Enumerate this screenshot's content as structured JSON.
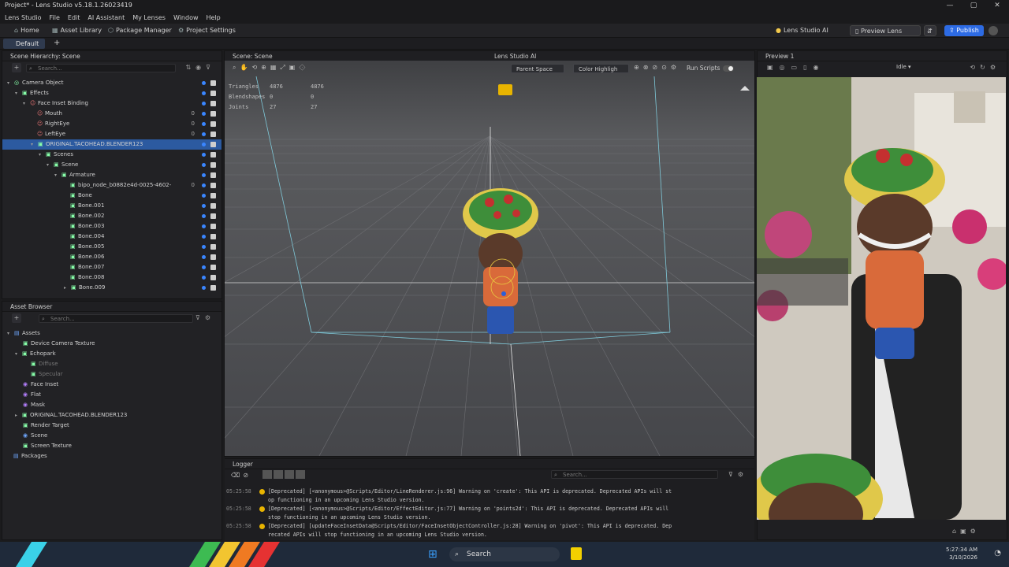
{
  "window": {
    "title": "Project* - Lens Studio v5.18.1.26023419",
    "controls": [
      "—",
      "▢",
      "✕"
    ]
  },
  "menu": [
    "Lens Studio",
    "File",
    "Edit",
    "AI Assistant",
    "My Lenses",
    "Window",
    "Help"
  ],
  "toolbar": {
    "home": "Home",
    "asset_library": "Asset Library",
    "package_manager": "Package Manager",
    "project_settings": "Project Settings",
    "lens_studio_ai": "Lens Studio AI",
    "preview_lens": "Preview Lens",
    "publish": "Publish"
  },
  "layout_tab": "Default",
  "scene_hierarchy": {
    "title": "Scene Hierarchy: Scene",
    "search_placeholder": "Search...",
    "items": [
      {
        "label": "Camera Object",
        "count": ""
      },
      {
        "label": "Effects",
        "count": ""
      },
      {
        "label": "Face Inset Binding",
        "count": ""
      },
      {
        "label": "Mouth",
        "count": "0"
      },
      {
        "label": "RightEye",
        "count": "0"
      },
      {
        "label": "LeftEye",
        "count": "0"
      },
      {
        "label": "ORIGINAL.TACOHEAD.BLENDER123",
        "count": ""
      },
      {
        "label": "Scenes",
        "count": ""
      },
      {
        "label": "Scene",
        "count": ""
      },
      {
        "label": "Armature",
        "count": ""
      },
      {
        "label": "bipo_node_b0882e4d-0025-4602-",
        "count": "0"
      },
      {
        "label": "Bone",
        "count": ""
      },
      {
        "label": "Bone.001",
        "count": ""
      },
      {
        "label": "Bone.002",
        "count": ""
      },
      {
        "label": "Bone.003",
        "count": ""
      },
      {
        "label": "Bone.004",
        "count": ""
      },
      {
        "label": "Bone.005",
        "count": ""
      },
      {
        "label": "Bone.006",
        "count": ""
      },
      {
        "label": "Bone.007",
        "count": ""
      },
      {
        "label": "Bone.008",
        "count": ""
      },
      {
        "label": "Bone.009",
        "count": ""
      }
    ]
  },
  "asset_browser": {
    "title": "Asset Browser",
    "search_placeholder": "Search...",
    "items": [
      {
        "label": "Assets"
      },
      {
        "label": "Device Camera Texture"
      },
      {
        "label": "Echopark"
      },
      {
        "label": "Diffuse"
      },
      {
        "label": "Specular"
      },
      {
        "label": "Face Inset"
      },
      {
        "label": "Flat"
      },
      {
        "label": "Mask"
      },
      {
        "label": "ORIGINAL.TACOHEAD.BLENDER123"
      },
      {
        "label": "Render Target"
      },
      {
        "label": "Scene"
      },
      {
        "label": "Screen Texture"
      },
      {
        "label": "Packages"
      }
    ]
  },
  "scene_view": {
    "title": "Scene: Scene",
    "lens_studio_ai": "Lens Studio AI",
    "parent_space": "Parent Space",
    "color_highlight": "Color Highligh",
    "run_scripts": "Run Scripts",
    "stats": [
      {
        "label": "Triangles",
        "a": "4876",
        "b": "4876"
      },
      {
        "label": "Blendshapes",
        "a": "0",
        "b": "0"
      },
      {
        "label": "Joints",
        "a": "27",
        "b": "27"
      }
    ]
  },
  "preview": {
    "title": "Preview 1",
    "mode": "Idle"
  },
  "logger": {
    "title": "Logger",
    "search_placeholder": "Search...",
    "rows": [
      {
        "time": "05:25:58",
        "line1": "[Deprecated] [<anonymous>@Scripts/Editor/LineRenderer.js:96] Warning on 'create': This API is deprecated. Deprecated APIs will st",
        "line2": "op functioning in an upcoming Lens Studio version."
      },
      {
        "time": "05:25:58",
        "line1": "[Deprecated] [<anonymous>@Scripts/Editor/EffectEditor.js:77] Warning on 'points2d': This API is deprecated. Deprecated APIs will",
        "line2": "stop functioning in an upcoming Lens Studio version."
      },
      {
        "time": "05:25:58",
        "line1": "[Deprecated] [updateFaceInsetData@Scripts/Editor/FaceInsetObjectController.js:28] Warning on 'pivot': This API is deprecated. Dep",
        "line2": "recated APIs will stop functioning in an upcoming Lens Studio version."
      }
    ]
  },
  "taskbar": {
    "search": "Search",
    "time": "5:27:34 AM",
    "date": "3/10/2026"
  },
  "colors": {
    "accent": "#2d6be4",
    "selection": "#2c5aa0",
    "warning": "#e8b400"
  }
}
